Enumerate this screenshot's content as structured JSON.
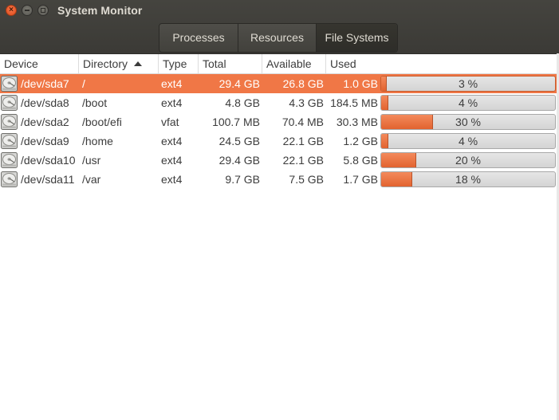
{
  "window": {
    "title": "System Monitor",
    "controls": {
      "close_glyph": "×",
      "minimize": "minimize",
      "maximize": "maximize"
    }
  },
  "tabs": [
    {
      "label": "Processes",
      "active": false
    },
    {
      "label": "Resources",
      "active": false
    },
    {
      "label": "File Systems",
      "active": true
    }
  ],
  "table": {
    "columns": [
      "Device",
      "Directory",
      "Type",
      "Total",
      "Available",
      "Used"
    ],
    "sorted_by": "Directory",
    "sort_direction": "ascending",
    "rows": [
      {
        "icon": "hard-disk-icon",
        "device": "/dev/sda7",
        "directory": "/",
        "type": "ext4",
        "total": "29.4 GB",
        "available": "26.8 GB",
        "used": "1.0 GB",
        "percent": 3,
        "percent_label": "3 %",
        "selected": true
      },
      {
        "icon": "hard-disk-icon",
        "device": "/dev/sda8",
        "directory": "/boot",
        "type": "ext4",
        "total": "4.8 GB",
        "available": "4.3 GB",
        "used": "184.5 MB",
        "percent": 4,
        "percent_label": "4 %",
        "selected": false
      },
      {
        "icon": "hard-disk-icon",
        "device": "/dev/sda2",
        "directory": "/boot/efi",
        "type": "vfat",
        "total": "100.7 MB",
        "available": "70.4 MB",
        "used": "30.3 MB",
        "percent": 30,
        "percent_label": "30 %",
        "selected": false
      },
      {
        "icon": "hard-disk-icon",
        "device": "/dev/sda9",
        "directory": "/home",
        "type": "ext4",
        "total": "24.5 GB",
        "available": "22.1 GB",
        "used": "1.2 GB",
        "percent": 4,
        "percent_label": "4 %",
        "selected": false
      },
      {
        "icon": "hard-disk-icon",
        "device": "/dev/sda10",
        "directory": "/usr",
        "type": "ext4",
        "total": "29.4 GB",
        "available": "22.1 GB",
        "used": "5.8 GB",
        "percent": 20,
        "percent_label": "20 %",
        "selected": false
      },
      {
        "icon": "hard-disk-icon",
        "device": "/dev/sda11",
        "directory": "/var",
        "type": "ext4",
        "total": "9.7 GB",
        "available": "7.5 GB",
        "used": "1.7 GB",
        "percent": 18,
        "percent_label": "18 %",
        "selected": false
      }
    ]
  },
  "colors": {
    "accent": "#f07746",
    "bar_fill": "#e2632f",
    "header_bg": "#3c3b37",
    "header_text": "#dfdbd2"
  }
}
